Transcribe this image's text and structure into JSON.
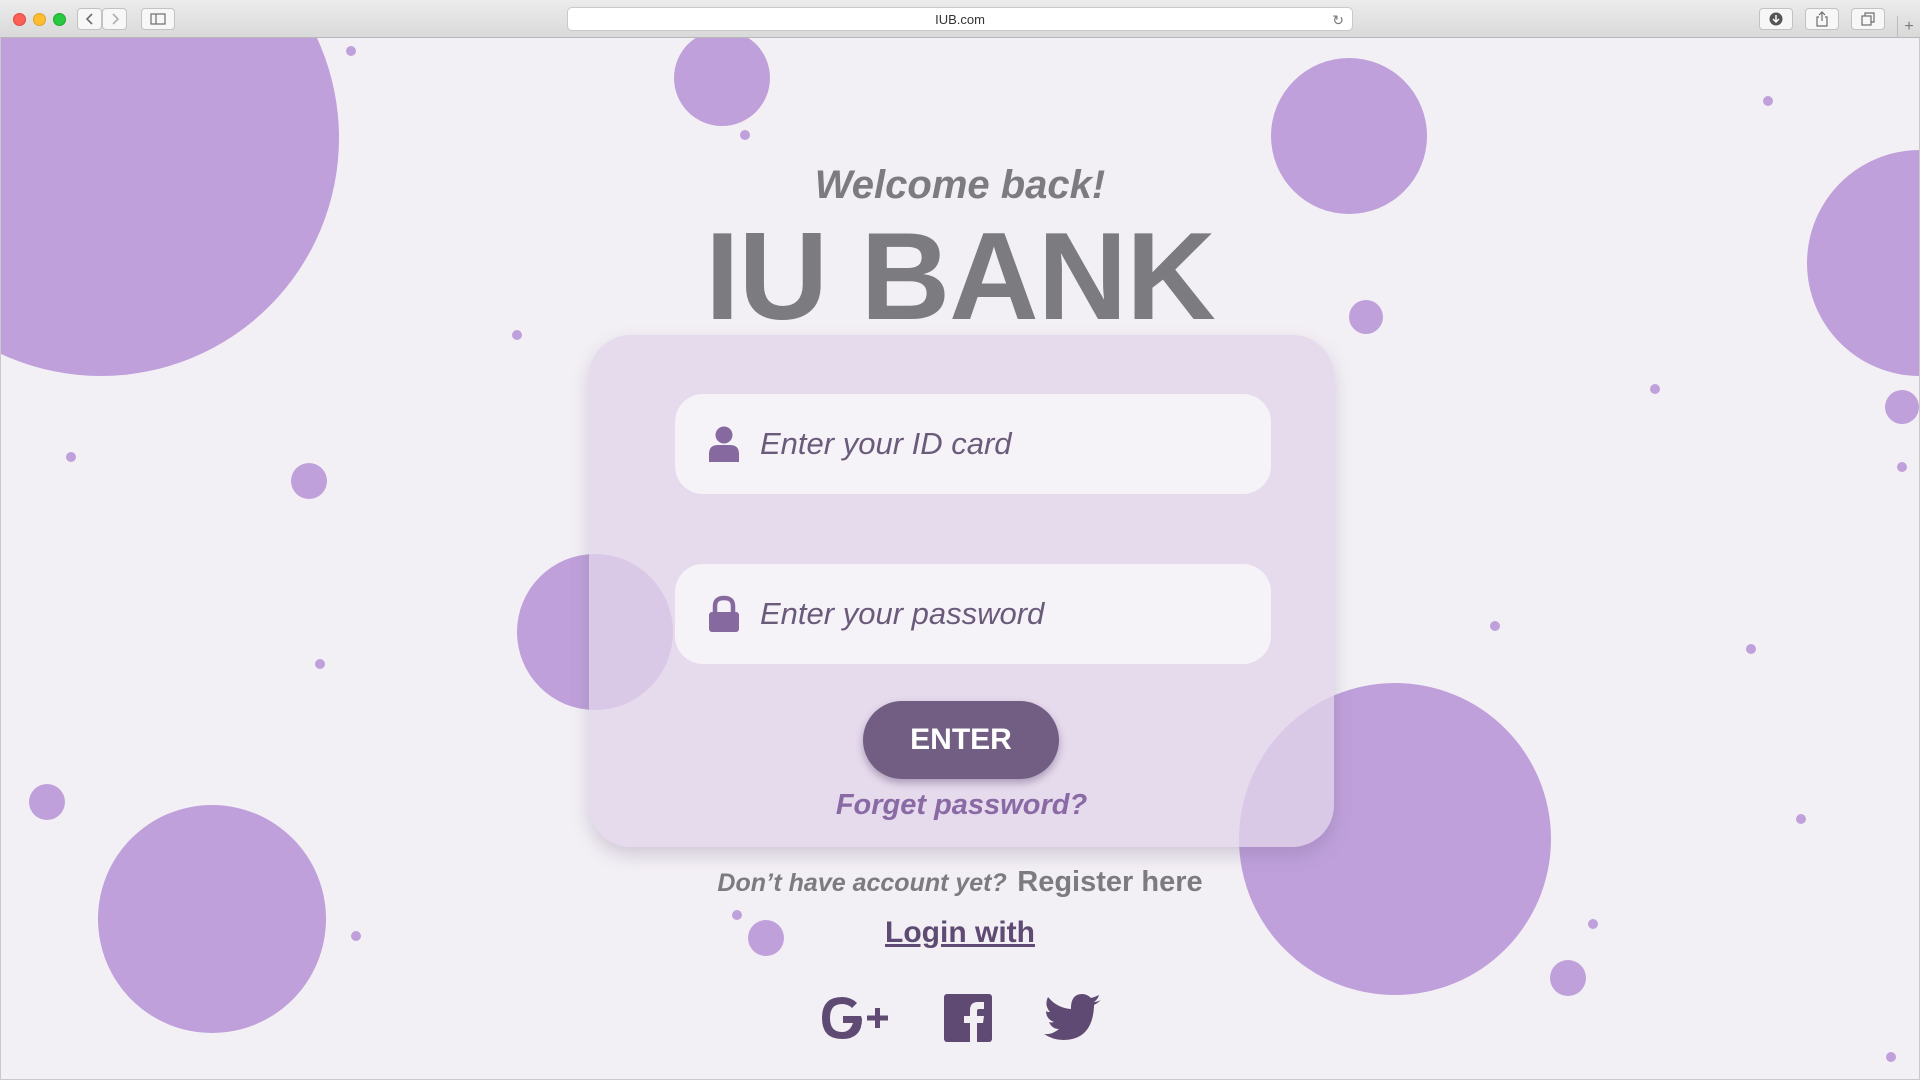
{
  "browser": {
    "url": "IUB.com",
    "back_icon": "chevron-left-icon",
    "forward_icon": "chevron-right-icon",
    "sidebar_icon": "sidebar-icon",
    "reload_icon": "reload-icon",
    "download_icon": "download-icon",
    "share_icon": "share-icon",
    "tabs_icon": "tabs-icon",
    "new_tab_label": "+"
  },
  "page": {
    "welcome": "Welcome back!",
    "title": "IU BANK",
    "id_field": {
      "placeholder": "Enter your ID card",
      "value": "",
      "icon": "user-icon"
    },
    "password_field": {
      "placeholder": "Enter your password",
      "value": "",
      "icon": "lock-icon"
    },
    "enter_label": "ENTER",
    "forget_password": "Forget password?",
    "register_question": "Don’t have account yet?",
    "register_link": "Register here",
    "login_with": "Login with",
    "social": [
      "google-plus-icon",
      "facebook-icon",
      "twitter-icon"
    ]
  },
  "colors": {
    "background": "#f3f0f5",
    "bubble": "#bfa0db",
    "card": "#e1d4eb",
    "accent": "#715e82",
    "heading": "#7c7b80",
    "link": "#8a6aa5",
    "social_icon": "#5e4a72"
  }
}
